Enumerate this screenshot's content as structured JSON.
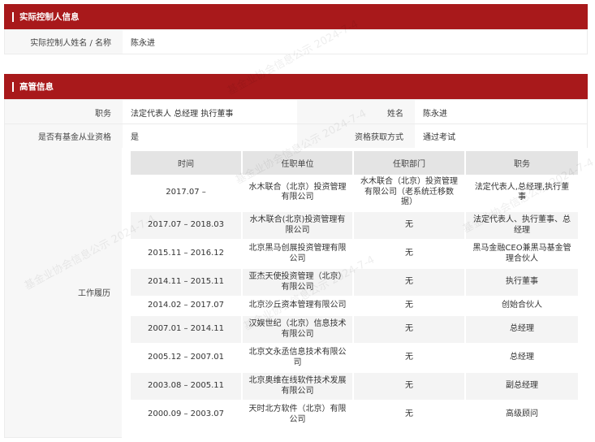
{
  "controller_section": {
    "title": "实际控制人信息",
    "name_label": "实际控制人姓名 / 名称",
    "name_value": "陈永进"
  },
  "exec_section": {
    "title": "高管信息",
    "position_label": "职务",
    "position_value": "法定代表人 总经理 执行董事",
    "name_label": "姓名",
    "name_value": "陈永进",
    "qualification_label": "是否有基金从业资格",
    "qualification_value": "是",
    "method_label": "资格获取方式",
    "method_value": "通过考试",
    "work_label": "工作履历"
  },
  "history": {
    "headers": [
      "时间",
      "任职单位",
      "任职部门",
      "职务"
    ],
    "rows": [
      {
        "time": "2017.07 –",
        "company": "水木联合（北京）投资管理有限公司",
        "dept": "水木联合（北京）投资管理有限公司（老系统迁移数据）",
        "role": "法定代表人,总经理,执行董事"
      },
      {
        "time": "2017.07 – 2018.03",
        "company": "水木联合(北京)投资管理有限公司",
        "dept": "无",
        "role": "法定代表人、执行董事、总经理"
      },
      {
        "time": "2015.11 – 2016.12",
        "company": "北京黑马创展投资管理有限公司",
        "dept": "无",
        "role": "黑马金融CEO兼黑马基金管理合伙人"
      },
      {
        "time": "2014.11 – 2015.11",
        "company": "亚杰天使投资管理（北京）有限公司",
        "dept": "无",
        "role": "执行董事"
      },
      {
        "time": "2014.02 – 2017.07",
        "company": "北京沙丘资本管理有限公司",
        "dept": "无",
        "role": "创始合伙人"
      },
      {
        "time": "2007.01 – 2014.11",
        "company": "汉娱世纪（北京）信息技术有限公司",
        "dept": "无",
        "role": "总经理"
      },
      {
        "time": "2005.12 – 2007.01",
        "company": "北京文永丞信息技术有限公司",
        "dept": "无",
        "role": "总经理"
      },
      {
        "time": "2003.08 – 2005.11",
        "company": "北京奥维在线软件技术发展有限公司",
        "dept": "无",
        "role": "副总经理"
      },
      {
        "time": "2000.09 – 2003.07",
        "company": "天时北方软件（北京）有限公司",
        "dept": "无",
        "role": "高级顾问"
      }
    ]
  },
  "watermark": "基金业协会信息公示 2024-7-4",
  "colors": {
    "header_bg": "#a8191b",
    "label_bg": "#f7f7f7",
    "table_header_bg": "#e4e4e4"
  }
}
